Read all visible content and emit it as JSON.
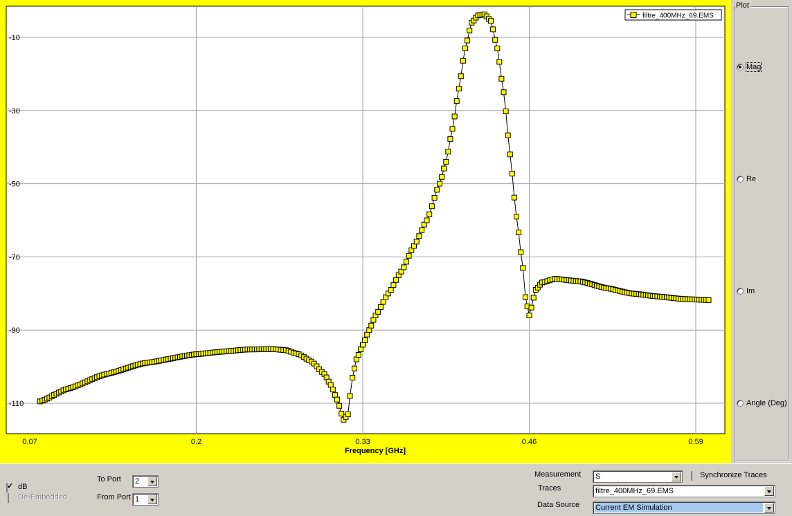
{
  "chart_data": {
    "type": "line",
    "title": "",
    "xlabel": "Frequency [GHz]",
    "ylabel": "",
    "xlim": [
      0.07,
      0.605
    ],
    "ylim": [
      -118,
      2
    ],
    "x_ticks": [
      0.07,
      0.2,
      0.33,
      0.46,
      0.59
    ],
    "x_tick_labels": [
      "0.07",
      "0.2",
      "0.33",
      "0.46",
      "0.59"
    ],
    "y_ticks": [
      -10,
      -30,
      -50,
      -70,
      -90,
      -110
    ],
    "y_tick_labels": [
      "-10",
      "-30",
      "-50",
      "-70",
      "-90",
      "-110"
    ],
    "grid": true,
    "legend": "top-right",
    "colors": {
      "background": "#ffff00",
      "plot": "#ffffff",
      "marker": "#ffff00",
      "line": "#000000",
      "grid": "#a0a0a0"
    },
    "series": [
      {
        "name": "filtre_400MHz_69.EMS",
        "marker": "square",
        "x": [
          0.078,
          0.1,
          0.13,
          0.16,
          0.2,
          0.22,
          0.24,
          0.26,
          0.27,
          0.28,
          0.29,
          0.3,
          0.305,
          0.31,
          0.315,
          0.3185,
          0.32,
          0.322,
          0.325,
          0.33,
          0.335,
          0.34,
          0.35,
          0.36,
          0.37,
          0.38,
          0.39,
          0.395,
          0.4,
          0.405,
          0.41,
          0.415,
          0.42,
          0.425,
          0.43,
          0.435,
          0.44,
          0.445,
          0.45,
          0.455,
          0.457,
          0.46,
          0.465,
          0.47,
          0.48,
          0.5,
          0.52,
          0.54,
          0.56,
          0.58,
          0.6
        ],
        "y": [
          -109.5,
          -106,
          -102,
          -99,
          -96.6,
          -95.9,
          -95.3,
          -95.2,
          -95.5,
          -96.6,
          -98.6,
          -102,
          -105,
          -109,
          -114.5,
          -113,
          -108,
          -103,
          -98,
          -94,
          -90,
          -86,
          -80,
          -74,
          -67,
          -60,
          -50,
          -44,
          -35,
          -24,
          -13,
          -6,
          -4,
          -3.7,
          -5.5,
          -13,
          -25,
          -42,
          -59,
          -73,
          -81,
          -86,
          -79,
          -77,
          -76,
          -76.7,
          -78.5,
          -80,
          -80.8,
          -81.5,
          -81.8
        ]
      }
    ]
  },
  "plot_options": {
    "title": "Plot",
    "options": [
      {
        "label": "Mag",
        "checked": true
      },
      {
        "label": "Re",
        "checked": false
      },
      {
        "label": "Im",
        "checked": false
      },
      {
        "label": "Angle (Deg)",
        "checked": false
      }
    ]
  },
  "controls": {
    "db_label": "dB",
    "db_checked": true,
    "deembedded_label": "De-Embedded",
    "deembedded_checked": false,
    "to_port_label": "To Port",
    "to_port_value": "2",
    "from_port_label": "From Port",
    "from_port_value": "1",
    "measurement_label": "Measurement",
    "measurement_value": "S",
    "sync_traces_label": "Synchronize Traces",
    "sync_traces_checked": false,
    "traces_label": "Traces",
    "traces_value": "filtre_400MHz_69.EMS",
    "data_source_label": "Data Source",
    "data_source_value": "Current EM Simulation"
  }
}
